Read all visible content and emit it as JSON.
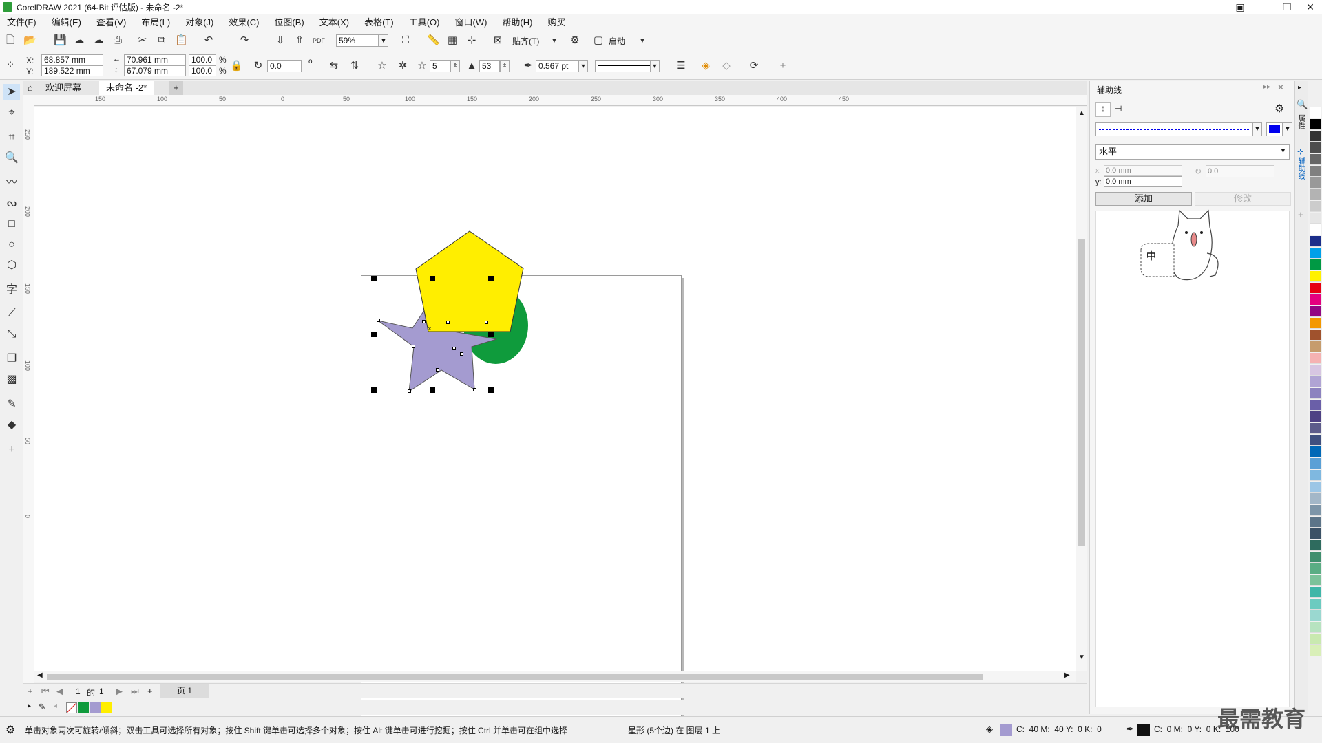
{
  "window": {
    "title": "CorelDRAW 2021 (64-Bit 评估版) - 未命名 -2*"
  },
  "menu": [
    "文件(F)",
    "编辑(E)",
    "查看(V)",
    "布局(L)",
    "对象(J)",
    "效果(C)",
    "位图(B)",
    "文本(X)",
    "表格(T)",
    "工具(O)",
    "窗口(W)",
    "帮助(H)",
    "购买"
  ],
  "std_toolbar": {
    "zoom": "59%",
    "snap_label": "贴齐(T)",
    "launch_label": "启动",
    "pdf_label": "PDF"
  },
  "props": {
    "x_label": "X:",
    "y_label": "Y:",
    "x": "68.857 mm",
    "y": "189.522 mm",
    "w": "70.961 mm",
    "h": "67.079 mm",
    "scale_w": "100.0",
    "scale_h": "100.0",
    "pct": "%",
    "rotation": "0.0",
    "deg": "o",
    "points": "5",
    "sharpness": "53",
    "outline": "0.567 pt"
  },
  "tabs": {
    "welcome": "欢迎屏幕",
    "doc": "未命名 -2*"
  },
  "hruler_ticks": [
    "150",
    "100",
    "50",
    "0",
    "50",
    "100",
    "150",
    "200",
    "250",
    "300",
    "350",
    "400",
    "450"
  ],
  "vruler_ticks": [
    "250",
    "200",
    "150",
    "100",
    "50",
    "0"
  ],
  "pagenav": {
    "current": "1",
    "of": "的",
    "total": "1",
    "page_tab": "页 1"
  },
  "status": {
    "hint": "单击对象两次可旋转/倾斜；双击工具可选择所有对象；按住 Shift 键单击可选择多个对象；按住 Alt 键单击可进行挖掘；按住 Ctrl 并单击可在组中选择",
    "object_info": "星形 (5个边) 在 图层 1 上",
    "fill_cmyk": "C:  40 M:  40 Y:  0 K:  0",
    "outline_cmyk": "C:  0 M:  0 Y:  0 K:  100"
  },
  "docker": {
    "title": "辅助线",
    "orientation": "水平",
    "x_val": "0.0 mm",
    "y_val": "0.0 mm",
    "y_label": "y:",
    "angle": "0.0",
    "add_btn": "添加",
    "modify_btn": "修改",
    "tab_props": "属性",
    "tab_guides": "辅助线",
    "guide_color": "#0000ee",
    "sticker_text": "中"
  },
  "watermark": "最需教育",
  "colors": {
    "star": "#a49bd0",
    "pentagon": "#ffee00",
    "ellipse": "#0f9b3c"
  },
  "doc_palette": [
    "#ffffff",
    "#0f9b3c",
    "#a49bd0",
    "#ffee00"
  ],
  "color_palette": [
    "#ffffff",
    "#000000",
    "#333333",
    "#4d4d4d",
    "#666666",
    "#808080",
    "#999999",
    "#b3b3b3",
    "#cccccc",
    "#e6e6e6",
    "#ffffff",
    "#1b2e8a",
    "#00a0e9",
    "#009944",
    "#fff100",
    "#e60012",
    "#e4007f",
    "#920783",
    "#f39800",
    "#a0522d",
    "#c69c6d",
    "#f5b2b2",
    "#d7c6e2",
    "#b0a4d4",
    "#8c82bf",
    "#6a5fa8",
    "#4e4184",
    "#5d5c8b",
    "#3f4f7f",
    "#0068b7",
    "#5aa0d6",
    "#7fb8e0",
    "#9cc6e6",
    "#a3b7c8",
    "#7d95a8",
    "#5c7488",
    "#3b5166",
    "#2e6b5e",
    "#3f8f6e",
    "#5aad84",
    "#7cc29a",
    "#3fb6a8",
    "#6ccbc0",
    "#9ad8d0",
    "#b7e3c0",
    "#c9e9b0",
    "#d9efb8"
  ]
}
